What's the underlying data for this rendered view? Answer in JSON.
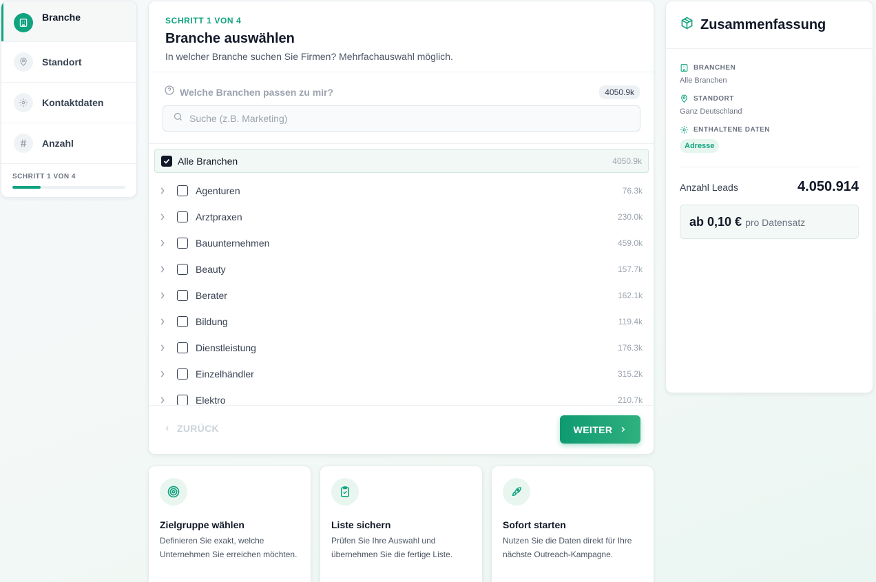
{
  "colors": {
    "accent": "#10a37f",
    "text_dark": "#111827",
    "muted": "#9ca3af"
  },
  "sidebar": {
    "items": [
      {
        "label": "Branche",
        "icon": "building-icon",
        "active": true
      },
      {
        "label": "Standort",
        "icon": "map-pin-icon",
        "active": false
      },
      {
        "label": "Kontaktdaten",
        "icon": "gear-icon",
        "active": false
      },
      {
        "label": "Anzahl",
        "icon": "hash-icon",
        "active": false
      }
    ],
    "progress_label": "SCHRITT 1 VON 4",
    "progress_fraction": 0.25
  },
  "main": {
    "eyebrow": "SCHRITT 1 VON 4",
    "title": "Branche auswählen",
    "subtitle": "In welcher Branche suchen Sie Firmen? Mehrfachauswahl möglich.",
    "help_text": "Welche Branchen passen zu mir?",
    "total_badge": "4050.9k",
    "search_placeholder": "Suche (z.B. Marketing)",
    "all": {
      "label": "Alle Branchen",
      "count": "4050.9k",
      "checked": true
    },
    "branches": [
      {
        "label": "Agenturen",
        "count": "76.3k"
      },
      {
        "label": "Arztpraxen",
        "count": "230.0k"
      },
      {
        "label": "Bauunternehmen",
        "count": "459.0k"
      },
      {
        "label": "Beauty",
        "count": "157.7k"
      },
      {
        "label": "Berater",
        "count": "162.1k"
      },
      {
        "label": "Bildung",
        "count": "119.4k"
      },
      {
        "label": "Dienstleistung",
        "count": "176.3k"
      },
      {
        "label": "Einzelhändler",
        "count": "315.2k"
      },
      {
        "label": "Elektro",
        "count": "210.7k"
      }
    ],
    "back_label": "ZURÜCK",
    "next_label": "WEITER"
  },
  "features": [
    {
      "icon": "target-icon",
      "title": "Zielgruppe wählen",
      "text": "Definieren Sie exakt, welche Unternehmen Sie erreichen möchten."
    },
    {
      "icon": "clipboard-check-icon",
      "title": "Liste sichern",
      "text": "Prüfen Sie Ihre Auswahl und übernehmen Sie die fertige Liste."
    },
    {
      "icon": "rocket-icon",
      "title": "Sofort starten",
      "text": "Nutzen Sie die Daten direkt für Ihre nächste Outreach-Kampagne."
    }
  ],
  "summary": {
    "title": "Zusammenfassung",
    "branchen_label": "BRANCHEN",
    "branchen_value": "Alle Branchen",
    "standort_label": "STANDORT",
    "standort_value": "Ganz Deutschland",
    "daten_label": "ENTHALTENE DATEN",
    "daten_tag": "Adresse",
    "leads_label": "Anzahl Leads",
    "leads_value": "4.050.914",
    "price": "ab 0,10 €",
    "price_unit": "pro Datensatz"
  }
}
